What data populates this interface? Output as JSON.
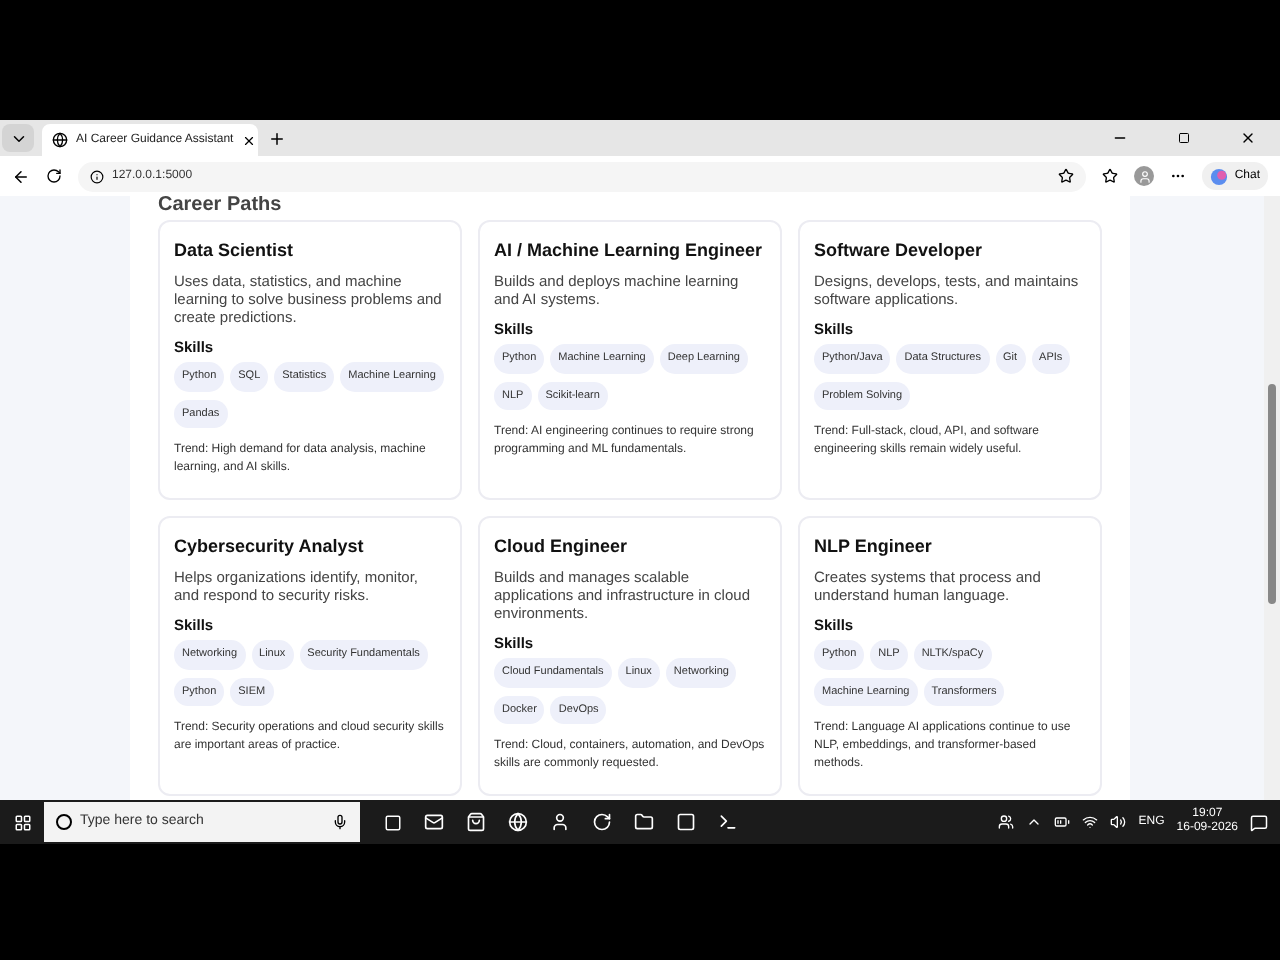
{
  "browser": {
    "tab_title": "AI Career Guidance Assistant",
    "url": "127.0.0.1:5000",
    "chat_label": "Chat"
  },
  "page": {
    "heading": "Career Paths",
    "cards": [
      {
        "title": "Data Scientist",
        "description": "Uses data, statistics, and machine learning to solve business problems and create predictions.",
        "skills_label": "Skills",
        "skills": [
          "Python",
          "SQL",
          "Statistics",
          "Machine Learning",
          "Pandas"
        ],
        "trend": "Trend: High demand for data analysis, machine learning, and AI skills."
      },
      {
        "title": "AI / Machine Learning Engineer",
        "description": "Builds and deploys machine learning and AI systems.",
        "skills_label": "Skills",
        "skills": [
          "Python",
          "Machine Learning",
          "Deep Learning",
          "NLP",
          "Scikit-learn"
        ],
        "trend": "Trend: AI engineering continues to require strong programming and ML fundamentals."
      },
      {
        "title": "Software Developer",
        "description": "Designs, develops, tests, and maintains software applications.",
        "skills_label": "Skills",
        "skills": [
          "Python/Java",
          "Data Structures",
          "Git",
          "APIs",
          "Problem Solving"
        ],
        "trend": "Trend: Full-stack, cloud, API, and software engineering skills remain widely useful."
      },
      {
        "title": "Cybersecurity Analyst",
        "description": "Helps organizations identify, monitor, and respond to security risks.",
        "skills_label": "Skills",
        "skills": [
          "Networking",
          "Linux",
          "Security Fundamentals",
          "Python",
          "SIEM"
        ],
        "trend": "Trend: Security operations and cloud security skills are important areas of practice."
      },
      {
        "title": "Cloud Engineer",
        "description": "Builds and manages scalable applications and infrastructure in cloud environments.",
        "skills_label": "Skills",
        "skills": [
          "Cloud Fundamentals",
          "Linux",
          "Networking",
          "Docker",
          "DevOps"
        ],
        "trend": "Trend: Cloud, containers, automation, and DevOps skills are commonly requested."
      },
      {
        "title": "NLP Engineer",
        "description": "Creates systems that process and understand human language.",
        "skills_label": "Skills",
        "skills": [
          "Python",
          "NLP",
          "NLTK/spaCy",
          "Machine Learning",
          "Transformers"
        ],
        "trend": "Trend: Language AI applications continue to use NLP, embeddings, and transformer-based methods."
      }
    ]
  },
  "taskbar": {
    "search_placeholder": "Type here to search",
    "language": "ENG",
    "time": "19:07",
    "date": "16-09-2026"
  }
}
